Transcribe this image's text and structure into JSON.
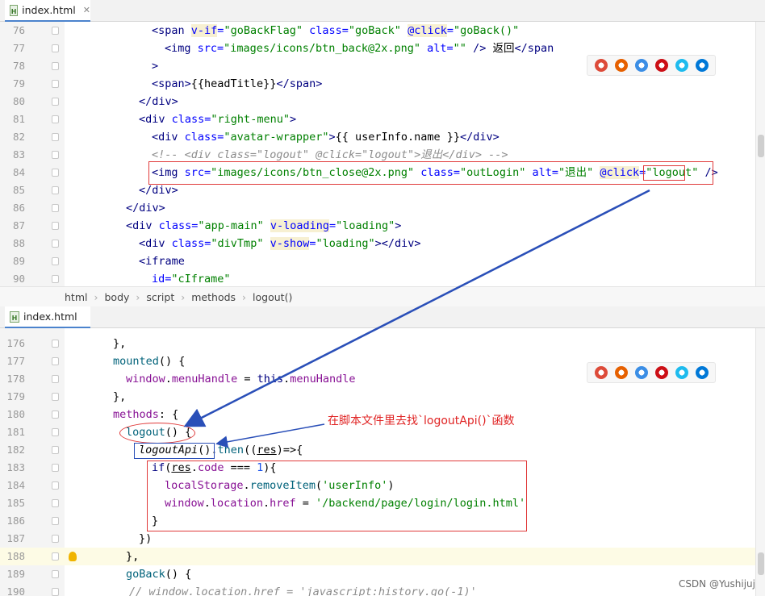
{
  "top_pane": {
    "tab_label": "index.html",
    "tab_icon": "H",
    "lines": [
      {
        "n": "76",
        "segs": [
          [
            "tag",
            "<span "
          ],
          [
            "vattr",
            "v-if"
          ],
          [
            "attr",
            "="
          ],
          [
            "str",
            "\"goBackFlag\""
          ],
          [
            "attr",
            " class"
          ],
          [
            "attr",
            "="
          ],
          [
            "str",
            "\"goBack\" "
          ],
          [
            "vattr",
            "@click"
          ],
          [
            "attr",
            "="
          ],
          [
            "str",
            "\"goBack()\""
          ]
        ]
      },
      {
        "n": "77",
        "segs": [
          [
            "tag",
            "<img "
          ],
          [
            "attr",
            "src"
          ],
          [
            "attr",
            "="
          ],
          [
            "str",
            "\"images/icons/btn_back@2x.png\" "
          ],
          [
            "attr",
            "alt"
          ],
          [
            "attr",
            "="
          ],
          [
            "str",
            "\"\" "
          ],
          [
            "tag",
            "/> "
          ],
          [
            "plain",
            "返回"
          ],
          [
            "tag",
            "</span"
          ]
        ]
      },
      {
        "n": "78",
        "segs": [
          [
            "tag",
            ">"
          ]
        ]
      },
      {
        "n": "79",
        "segs": [
          [
            "tag",
            "<span>"
          ],
          [
            "plain",
            "{{headTitle}}"
          ],
          [
            "tag",
            "</span>"
          ]
        ]
      },
      {
        "n": "80",
        "segs": [
          [
            "tag",
            "</div>"
          ]
        ]
      },
      {
        "n": "81",
        "segs": [
          [
            "tag",
            "<div "
          ],
          [
            "attr",
            "class"
          ],
          [
            "attr",
            "="
          ],
          [
            "str",
            "\"right-menu\""
          ],
          [
            "tag",
            ">"
          ]
        ]
      },
      {
        "n": "82",
        "segs": [
          [
            "tag",
            "<div "
          ],
          [
            "attr",
            "class"
          ],
          [
            "attr",
            "="
          ],
          [
            "str",
            "\"avatar-wrapper\""
          ],
          [
            "tag",
            ">"
          ],
          [
            "plain",
            "{{ userInfo.name }}"
          ],
          [
            "tag",
            "</div>"
          ]
        ]
      },
      {
        "n": "83",
        "segs": [
          [
            "cm",
            "<!-- <div class=\"logout\" @click=\"logout\">退出</div> -->"
          ]
        ]
      },
      {
        "n": "84",
        "segs": [
          [
            "tag",
            "<img "
          ],
          [
            "attr",
            "src"
          ],
          [
            "attr",
            "="
          ],
          [
            "str",
            "\"images/icons/btn_close@2x.png\" "
          ],
          [
            "attr",
            "class"
          ],
          [
            "attr",
            "="
          ],
          [
            "str",
            "\"outLogin\" "
          ],
          [
            "attr",
            "alt"
          ],
          [
            "attr",
            "="
          ],
          [
            "str",
            "\"退出\" "
          ],
          [
            "vattr",
            "@click"
          ],
          [
            "attr",
            "="
          ],
          [
            "str",
            "\"logout\" "
          ],
          [
            "tag",
            "/>"
          ]
        ]
      },
      {
        "n": "85",
        "segs": [
          [
            "tag",
            "</div>"
          ]
        ]
      },
      {
        "n": "86",
        "segs": [
          [
            "tag",
            "</div>"
          ]
        ]
      },
      {
        "n": "87",
        "segs": [
          [
            "tag",
            "<div "
          ],
          [
            "attr",
            "class"
          ],
          [
            "attr",
            "="
          ],
          [
            "str",
            "\"app-main\" "
          ],
          [
            "vattr",
            "v-loading"
          ],
          [
            "attr",
            "="
          ],
          [
            "str",
            "\"loading\""
          ],
          [
            "tag",
            ">"
          ]
        ]
      },
      {
        "n": "88",
        "segs": [
          [
            "tag",
            "<div "
          ],
          [
            "attr",
            "class"
          ],
          [
            "attr",
            "="
          ],
          [
            "str",
            "\"divTmp\" "
          ],
          [
            "vattr",
            "v-show"
          ],
          [
            "attr",
            "="
          ],
          [
            "str",
            "\"loading\""
          ],
          [
            "tag",
            "></div>"
          ]
        ]
      },
      {
        "n": "89",
        "segs": [
          [
            "tag",
            "<iframe"
          ]
        ]
      },
      {
        "n": "90",
        "segs": [
          [
            "attr",
            "id"
          ],
          [
            "attr",
            "="
          ],
          [
            "str",
            "\"cIframe\""
          ]
        ]
      }
    ],
    "breadcrumb": [
      "html",
      "body",
      "script",
      "methods",
      "logout()"
    ]
  },
  "bottom_pane": {
    "tab_label": "index.html",
    "tab_icon": "H",
    "lines": [
      {
        "n": "176",
        "segs": [
          [
            "plain",
            "},"
          ]
        ]
      },
      {
        "n": "177",
        "segs": [
          [
            "fn",
            "mounted"
          ],
          [
            "plain",
            "() {"
          ]
        ]
      },
      {
        "n": "178",
        "segs": [
          [
            "prop",
            "window"
          ],
          [
            "plain",
            "."
          ],
          [
            "prop",
            "menuHandle"
          ],
          [
            "plain",
            " = "
          ],
          [
            "kw",
            "this"
          ],
          [
            "plain",
            "."
          ],
          [
            "prop",
            "menuHandle"
          ]
        ]
      },
      {
        "n": "179",
        "segs": [
          [
            "plain",
            "},"
          ]
        ]
      },
      {
        "n": "180",
        "segs": [
          [
            "prop",
            "methods"
          ],
          [
            "plain",
            ": {"
          ]
        ]
      },
      {
        "n": "181",
        "segs": [
          [
            "fn",
            "logout"
          ],
          [
            "plain",
            "() {"
          ]
        ]
      },
      {
        "n": "182",
        "segs": [
          [
            "ital",
            "logoutApi"
          ],
          [
            "plain",
            "()."
          ],
          [
            "fn",
            "then"
          ],
          [
            "plain",
            "(("
          ],
          [
            "ul",
            "res"
          ],
          [
            "plain",
            ")=>{"
          ]
        ]
      },
      {
        "n": "183",
        "segs": [
          [
            "kw",
            "if"
          ],
          [
            "plain",
            "("
          ],
          [
            "ul",
            "res"
          ],
          [
            "plain",
            "."
          ],
          [
            "prop",
            "code"
          ],
          [
            "plain",
            " === "
          ],
          [
            "num",
            "1"
          ],
          [
            "plain",
            "){"
          ]
        ]
      },
      {
        "n": "184",
        "segs": [
          [
            "prop",
            "localStorage"
          ],
          [
            "plain",
            "."
          ],
          [
            "fn",
            "removeItem"
          ],
          [
            "plain",
            "("
          ],
          [
            "str",
            "'userInfo'"
          ],
          [
            "plain",
            ")"
          ]
        ]
      },
      {
        "n": "185",
        "segs": [
          [
            "prop",
            "window"
          ],
          [
            "plain",
            "."
          ],
          [
            "prop",
            "location"
          ],
          [
            "plain",
            "."
          ],
          [
            "prop",
            "href"
          ],
          [
            "plain",
            " = "
          ],
          [
            "str",
            "'/backend/page/login/login.html'"
          ]
        ]
      },
      {
        "n": "186",
        "segs": [
          [
            "plain",
            "}"
          ]
        ]
      },
      {
        "n": "187",
        "segs": [
          [
            "plain",
            "})"
          ]
        ]
      },
      {
        "n": "188",
        "segs": [
          [
            "plain",
            "},"
          ]
        ]
      },
      {
        "n": "189",
        "segs": [
          [
            "fn",
            "goBack"
          ],
          [
            "plain",
            "() {"
          ]
        ]
      },
      {
        "n": "190",
        "segs": [
          [
            "cm",
            "// window.location.href = 'javascript:history.go(-1)'"
          ]
        ]
      }
    ]
  },
  "browser_icons": [
    {
      "name": "chrome-icon",
      "color": "#dd4b39"
    },
    {
      "name": "firefox-icon",
      "color": "#e66000"
    },
    {
      "name": "safari-icon",
      "color": "#3b8ee5"
    },
    {
      "name": "opera-icon",
      "color": "#cc0f16"
    },
    {
      "name": "ie-icon",
      "color": "#1ebbee"
    },
    {
      "name": "edge-icon",
      "color": "#0078d7"
    }
  ],
  "annotation_text": "在脚本文件里去找`logoutApi()`函数",
  "watermark": "CSDN @Yushijuj",
  "colors": {
    "red": "#e03a3a",
    "blue": "#2a4fb8",
    "caret_bulb": "#f0b400"
  }
}
